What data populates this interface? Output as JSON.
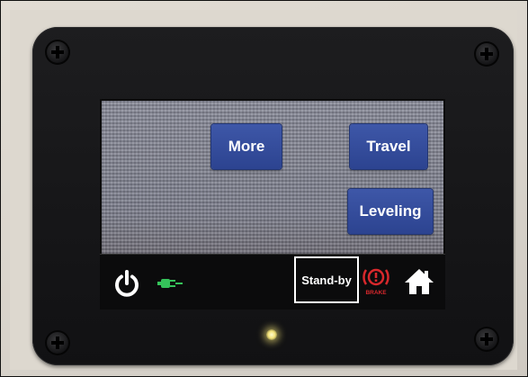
{
  "buttons": {
    "more": "More",
    "travel": "Travel",
    "leveling": "Leveling"
  },
  "status_bar": {
    "mode_label": "Stand-by",
    "brake_label": "BRAKE"
  },
  "icons": {
    "power": "power-icon",
    "connection": "plug-icon",
    "brake": "brake-warning-icon",
    "home": "home-icon"
  },
  "colors": {
    "button_blue": "#34499c",
    "plug_green": "#35c35a",
    "brake_red": "#d8282c",
    "led_yellow": "#f2e27a"
  }
}
